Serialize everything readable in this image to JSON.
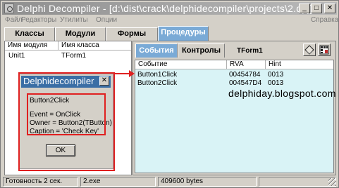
{
  "window": {
    "title": "Delphi Decompiler - [d:\\dist\\crack\\delphidecompiler\\projects\\2.dpj]",
    "minimize_label": "_",
    "maximize_label": "□",
    "close_label": "✕"
  },
  "menu": {
    "items": [
      "Файл",
      "Редакторы",
      "Утилиты",
      "Опции"
    ],
    "help": "Справка"
  },
  "tabs": [
    "Классы",
    "Модули",
    "Формы",
    "Процедуры"
  ],
  "active_tab": "Процедуры",
  "left_table": {
    "columns": [
      "Имя модуля",
      "Имя класса"
    ],
    "rows": [
      {
        "module": "Unit1",
        "class": "TForm1"
      }
    ]
  },
  "right_panel": {
    "tabs": [
      "События",
      "Контролы"
    ],
    "form_name": "TForm1",
    "icons": [
      "diamond-icon",
      "grid-icon"
    ],
    "columns": [
      "Событие",
      "RVA",
      "Hint"
    ],
    "rows": [
      {
        "event": "Button1Click",
        "rva": "00454784",
        "hint": "0013"
      },
      {
        "event": "Button2Click",
        "rva": "004547D4",
        "hint": "0013"
      }
    ]
  },
  "watermark": "delphiday.blogspot.com",
  "dialog": {
    "title": "Delphidecompiler",
    "close_label": "✕",
    "lines": [
      "Button2Click",
      "Event = OnClick",
      "Owner = Button2(TButton)",
      "Caption = 'Check Key'"
    ],
    "ok_label": "OK"
  },
  "status": {
    "ready": "Готовность 2 сек.",
    "file": "2.exe",
    "size": "409600 bytes"
  },
  "colors": {
    "active_tab": "#7aaad6",
    "list_bg": "#d9f3f6",
    "annotation_red": "#e02020",
    "dialog_title": "#3a6ea5"
  }
}
